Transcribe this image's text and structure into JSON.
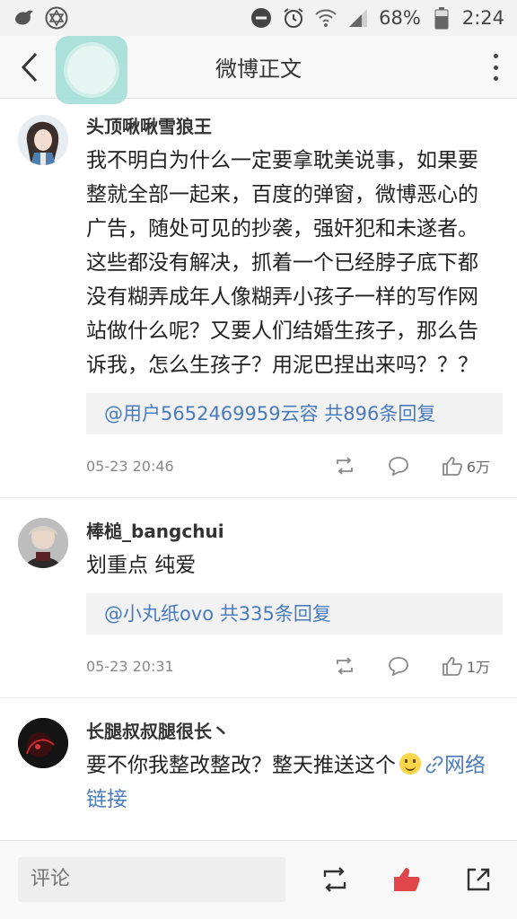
{
  "status_bar": {
    "left_icons": [
      "bird-notification-icon",
      "star-of-david-icon"
    ],
    "battery": "68%",
    "time": "2:24"
  },
  "nav": {
    "title": "微博正文"
  },
  "comments": [
    {
      "username": "头顶啾啾雪狼王",
      "text": "我不明白为什么一定要拿耽美说事，如果要整就全部一起来，百度的弹窗，微博恶心的广告，随处可见的抄袭，强奸犯和未遂者。这些都没有解决，抓着一个已经脖子底下都没有糊弄成年人像糊弄小孩子一样的写作网站做什么呢？又要人们结婚生孩子，那么告诉我，怎么生孩子？用泥巴捏出来吗？？？",
      "reply_summary": "@用户5652469959云容 共896条回复",
      "time": "05-23 20:46",
      "likes": "6万"
    },
    {
      "username": "棒槌_bangchui",
      "text": "划重点 纯爱",
      "reply_summary": "@小丸纸ovo 共335条回复",
      "time": "05-23 20:31",
      "likes": "1万"
    },
    {
      "username": "长腿叔叔腿很长丶",
      "text_before": "要不你我整改整改？整天推送这个",
      "link_text": "网络链接"
    }
  ],
  "bottom_bar": {
    "comment_placeholder": "评论"
  },
  "colors": {
    "link": "#4a7bbd",
    "like_active": "#e0464a",
    "widget": "#9fdcd6"
  }
}
